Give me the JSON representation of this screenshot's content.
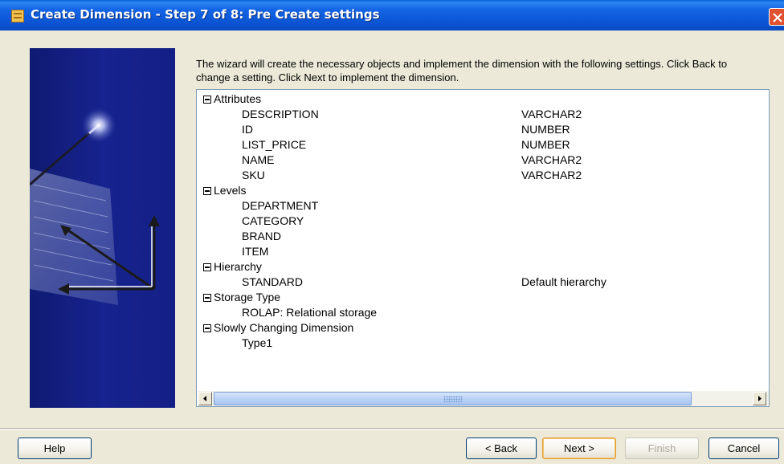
{
  "window": {
    "title": "Create Dimension - Step 7 of 8: Pre Create settings"
  },
  "description": "The wizard will create the necessary objects and implement the dimension with the following settings. Click Back to change a setting. Click Next to implement the dimension.",
  "tree": {
    "attributes": {
      "label": "Attributes",
      "items": [
        {
          "name": "DESCRIPTION",
          "value": "VARCHAR2"
        },
        {
          "name": "ID",
          "value": "NUMBER"
        },
        {
          "name": "LIST_PRICE",
          "value": "NUMBER"
        },
        {
          "name": "NAME",
          "value": "VARCHAR2"
        },
        {
          "name": "SKU",
          "value": "VARCHAR2"
        }
      ]
    },
    "levels": {
      "label": "Levels",
      "items": [
        {
          "name": "DEPARTMENT"
        },
        {
          "name": "CATEGORY"
        },
        {
          "name": "BRAND"
        },
        {
          "name": "ITEM"
        }
      ]
    },
    "hierarchy": {
      "label": "Hierarchy",
      "items": [
        {
          "name": "STANDARD",
          "value": "Default hierarchy"
        }
      ]
    },
    "storage": {
      "label": "Storage Type",
      "items": [
        {
          "name": "ROLAP: Relational storage"
        }
      ]
    },
    "scd": {
      "label": "Slowly Changing Dimension",
      "items": [
        {
          "name": "Type1"
        }
      ]
    }
  },
  "buttons": {
    "help": "Help",
    "back": "< Back",
    "next": "Next >",
    "finish": "Finish",
    "cancel": "Cancel"
  },
  "colors": {
    "titlebar": "#0b56d6",
    "banner": "#17238e",
    "default_button_border": "#e39c2f"
  }
}
